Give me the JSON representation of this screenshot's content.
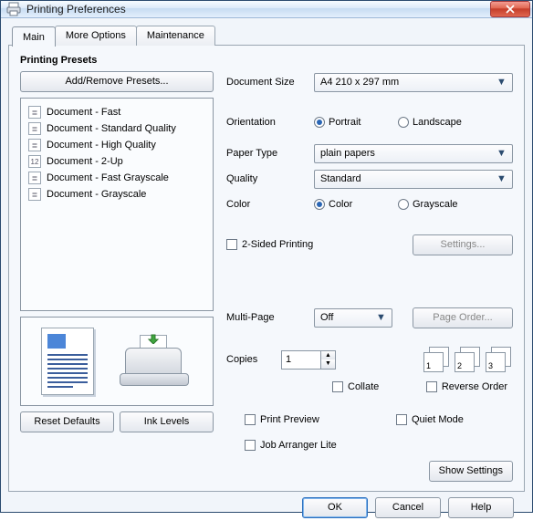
{
  "window": {
    "title": "Printing Preferences"
  },
  "tabs": [
    "Main",
    "More Options",
    "Maintenance"
  ],
  "presets": {
    "heading": "Printing Presets",
    "add_remove_label": "Add/Remove Presets...",
    "items": [
      "Document - Fast",
      "Document - Standard Quality",
      "Document - High Quality",
      "Document - 2-Up",
      "Document - Fast Grayscale",
      "Document - Grayscale"
    ]
  },
  "left_buttons": {
    "reset_defaults": "Reset Defaults",
    "ink_levels": "Ink Levels"
  },
  "right": {
    "doc_size_label": "Document Size",
    "doc_size_value": "A4 210 x 297 mm",
    "orientation_label": "Orientation",
    "orientation_portrait": "Portrait",
    "orientation_landscape": "Landscape",
    "paper_type_label": "Paper Type",
    "paper_type_value": "plain papers",
    "quality_label": "Quality",
    "quality_value": "Standard",
    "color_label": "Color",
    "color_color": "Color",
    "color_grayscale": "Grayscale",
    "two_sided_label": "2-Sided Printing",
    "settings_btn": "Settings...",
    "multi_page_label": "Multi-Page",
    "multi_page_value": "Off",
    "page_order_btn": "Page Order...",
    "copies_label": "Copies",
    "copies_value": "1",
    "collate_label": "Collate",
    "reverse_order_label": "Reverse Order",
    "print_preview_label": "Print Preview",
    "quiet_mode_label": "Quiet Mode",
    "job_arranger_label": "Job Arranger Lite",
    "show_settings_btn": "Show Settings"
  },
  "footer": {
    "ok": "OK",
    "cancel": "Cancel",
    "help": "Help"
  },
  "thumbs": {
    "n1": "1",
    "n2": "2",
    "n3": "3"
  }
}
